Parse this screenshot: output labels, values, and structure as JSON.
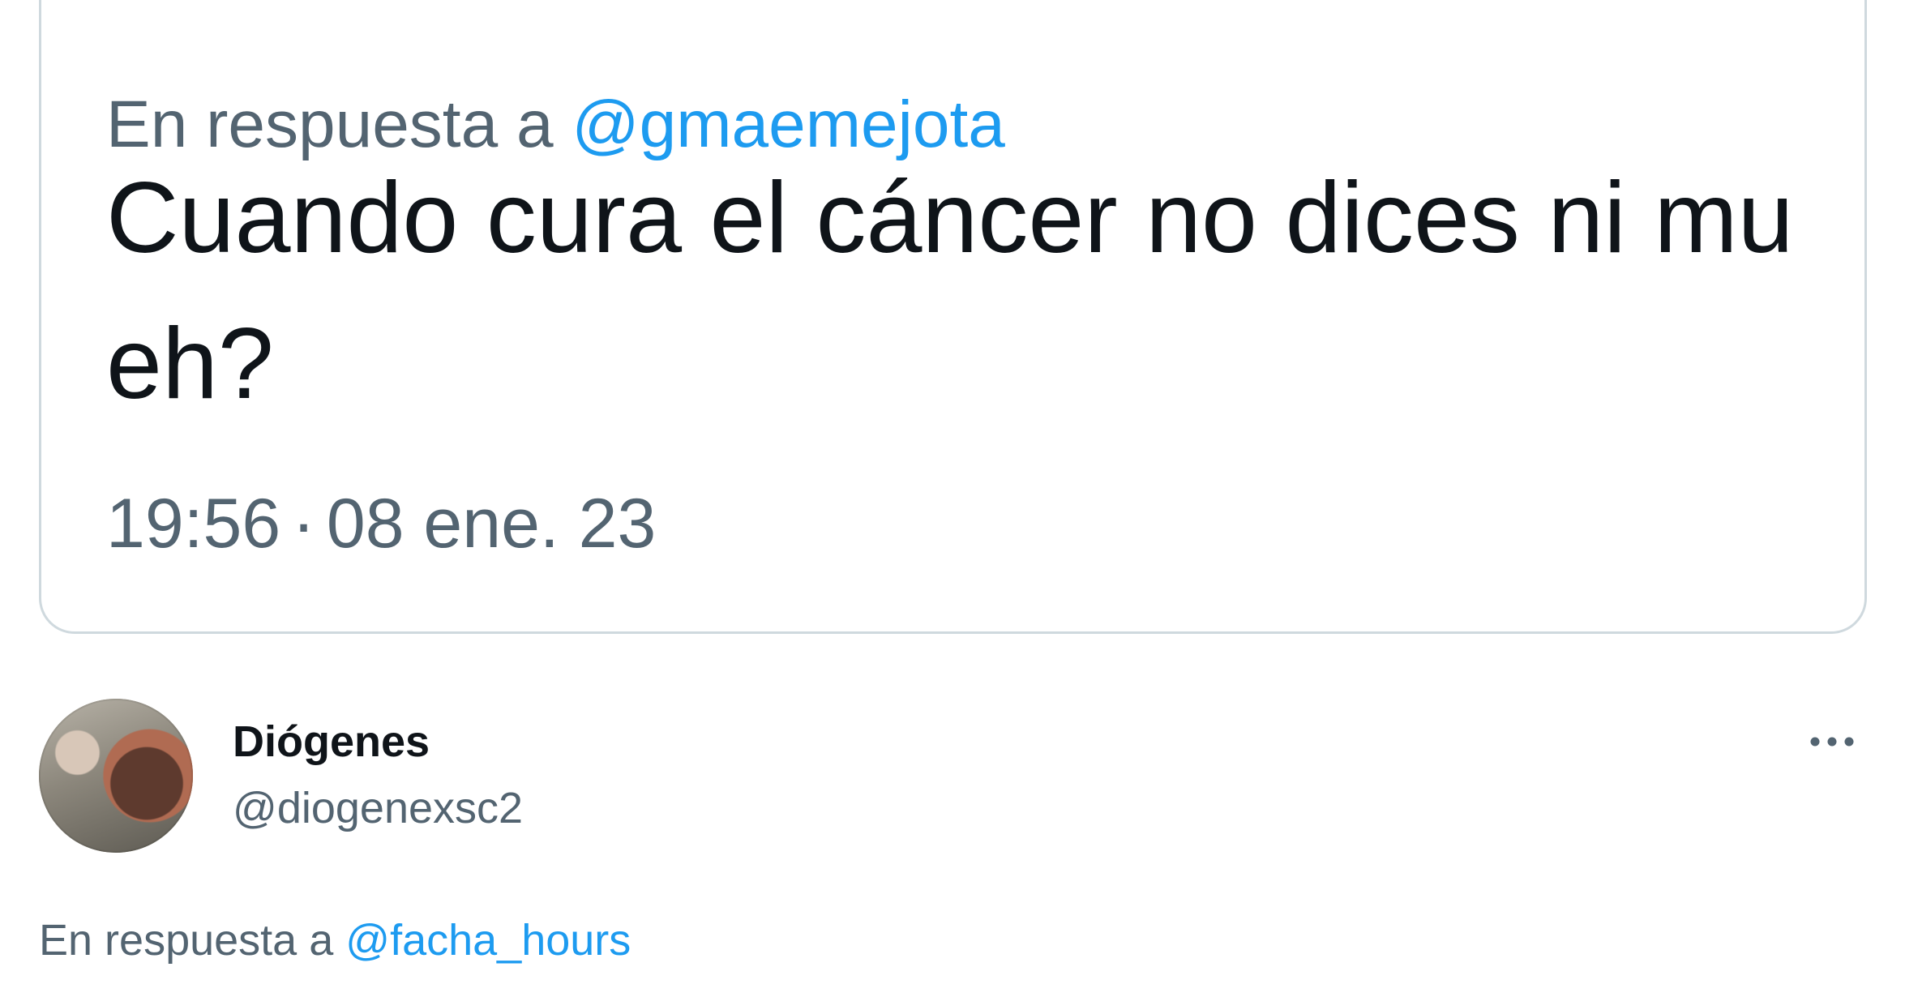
{
  "quoted_tweet": {
    "reply_prefix": "En respuesta a",
    "reply_mention": "@gmaemejota",
    "text": "Cuando cura el cáncer no dices ni mu eh?",
    "time": "19:56",
    "separator": "·",
    "date": "08 ene. 23"
  },
  "reply_tweet": {
    "display_name": "Diógenes",
    "handle": "@diogenexsc2",
    "reply_prefix": "En respuesta a",
    "reply_mention": "@facha_hours",
    "more_icon": "more-horizontal-icon"
  },
  "colors": {
    "text_primary": "#0f1419",
    "text_secondary": "#536471",
    "link": "#1d9bf0",
    "border": "#cfd9de"
  }
}
